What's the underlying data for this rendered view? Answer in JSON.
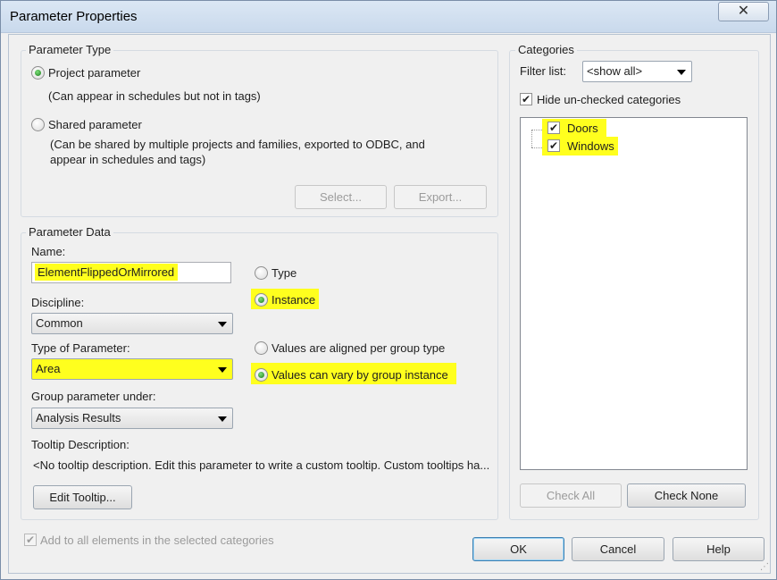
{
  "window": {
    "title": "Parameter Properties",
    "close_glyph": "✕"
  },
  "parameter_type": {
    "legend": "Parameter Type",
    "project_label": "Project parameter",
    "project_desc": "(Can appear in schedules but not in tags)",
    "shared_label": "Shared parameter",
    "shared_desc_1": "(Can be shared by multiple projects and families, exported to ODBC, and",
    "shared_desc_2": "appear in schedules and tags)",
    "select_label": "Select...",
    "export_label": "Export..."
  },
  "parameter_data": {
    "legend": "Parameter Data",
    "name_label": "Name:",
    "name_value": "ElementFlippedOrMirrored",
    "type_label": "Type",
    "instance_label": "Instance",
    "discipline_label": "Discipline:",
    "discipline_value": "Common",
    "type_of_param_label": "Type of Parameter:",
    "type_of_param_value": "Area",
    "aligned_label": "Values are aligned per group type",
    "vary_label": "Values can vary by group instance",
    "group_label": "Group parameter under:",
    "group_value": "Analysis Results",
    "tooltip_label": "Tooltip Description:",
    "tooltip_text": "<No tooltip description. Edit this parameter to write a custom tooltip. Custom tooltips ha...",
    "edit_tooltip_label": "Edit Tooltip..."
  },
  "categories": {
    "legend": "Categories",
    "filter_label": "Filter list:",
    "filter_value": "<show all>",
    "hide_label": "Hide un-checked categories",
    "items": [
      "Doors",
      "Windows"
    ],
    "check_all_label": "Check All",
    "check_none_label": "Check None"
  },
  "footer": {
    "add_all_label": "Add to all elements in the selected categories",
    "ok_label": "OK",
    "cancel_label": "Cancel",
    "help_label": "Help"
  },
  "colors": {
    "highlight": "#ffff1e",
    "title_bar": "#c9d9ec"
  }
}
